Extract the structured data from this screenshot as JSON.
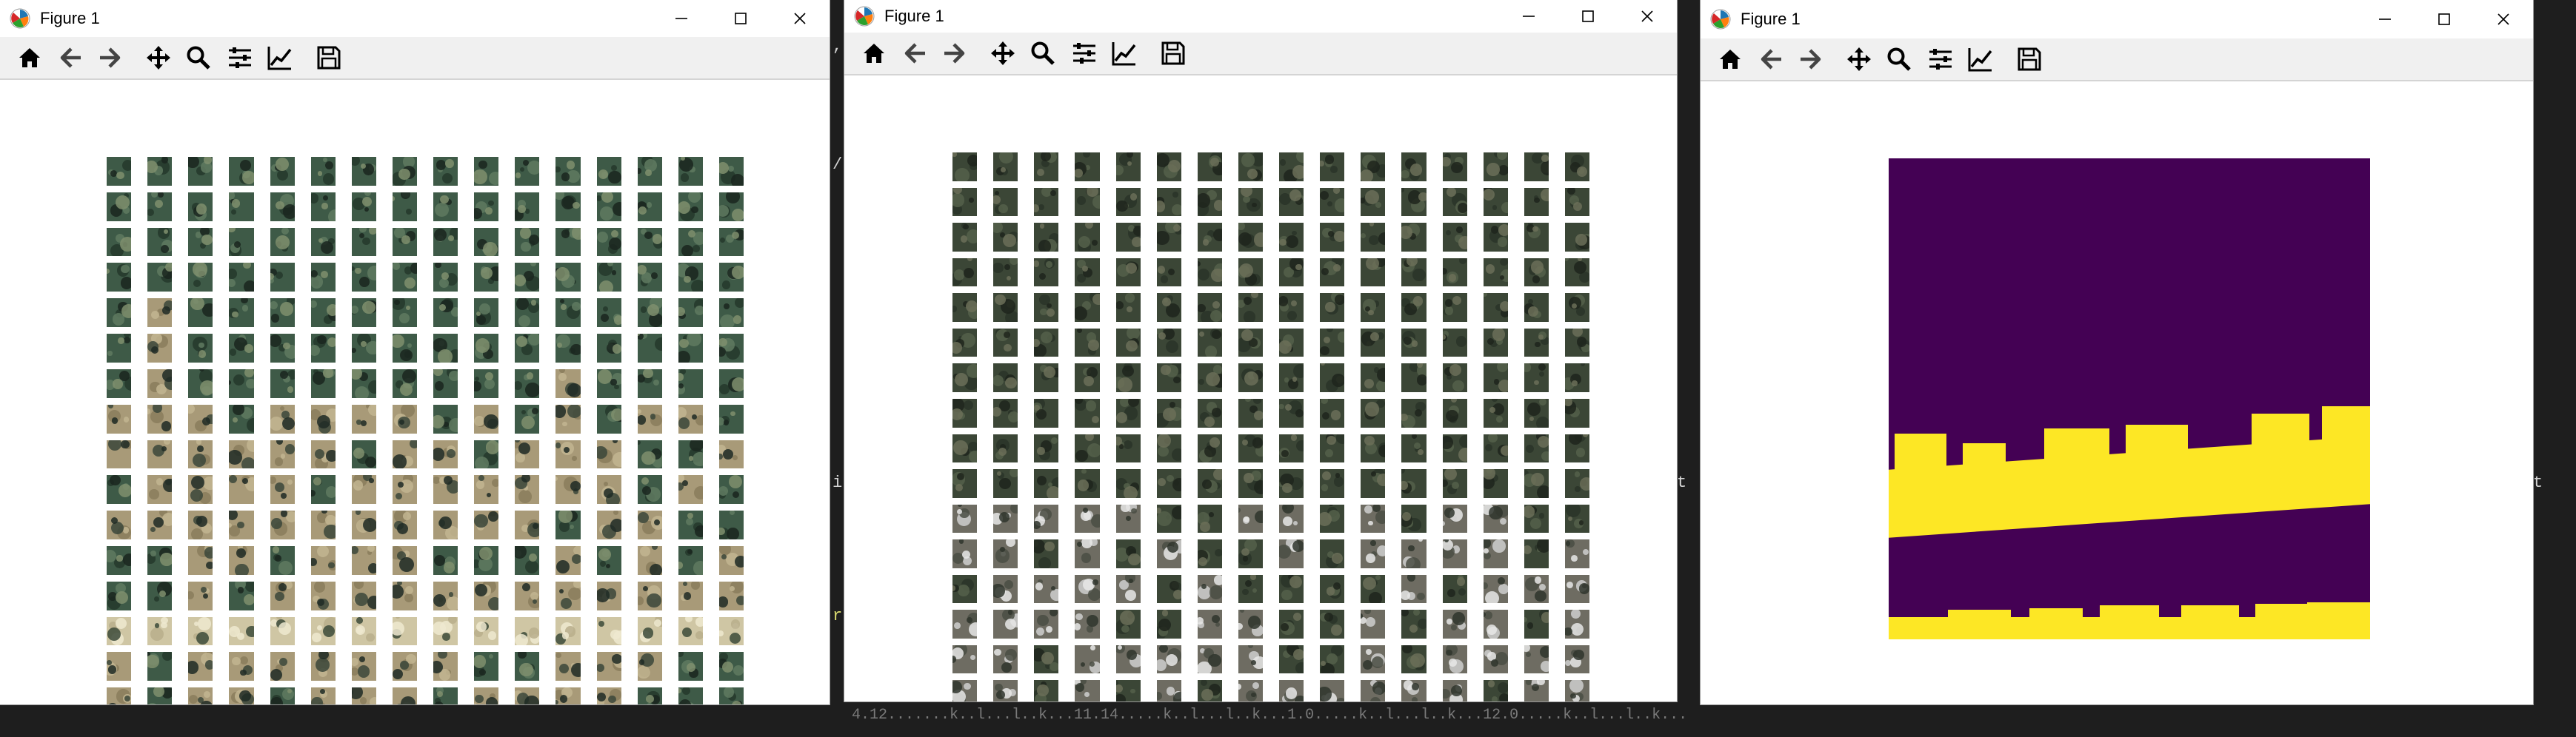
{
  "windows": [
    {
      "title": "Figure 1"
    },
    {
      "title": "Figure 1"
    },
    {
      "title": "Figure 1"
    }
  ],
  "toolbar_icons": [
    "home-icon",
    "back-icon",
    "forward-icon",
    "pan-icon",
    "zoom-icon",
    "subplots-icon",
    "axes-edit-icon",
    "save-icon"
  ],
  "background_fragments": [
    ",",
    "/",
    "i",
    "r",
    "t",
    "t",
    "t"
  ],
  "background_line": "4.12.......k..l...l..k...11.14.....k..l...l..k...1.0.....k..l...l..k...12.0.....k..l...l..k...",
  "colors": {
    "viridis_purple": "#440154",
    "viridis_yellow": "#fde725",
    "window_bg": "#ffffff",
    "toolbar_bg": "#f0f0f0"
  },
  "grids": {
    "rows": 16,
    "cols": 16
  }
}
